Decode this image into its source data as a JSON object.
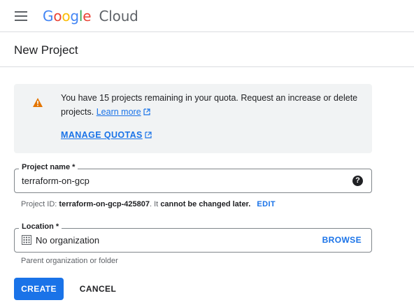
{
  "header": {
    "logo_letters": [
      "G",
      "o",
      "o",
      "g",
      "l",
      "e"
    ],
    "logo_colors": [
      "#4285f4",
      "#ea4335",
      "#fbbc05",
      "#4285f4",
      "#34a853",
      "#ea4335"
    ],
    "logo_suffix": "Cloud",
    "menu_icon": "hamburger-menu-icon"
  },
  "page": {
    "title": "New Project"
  },
  "quota_notice": {
    "text": "You have 15 projects remaining in your quota. Request an increase or delete projects.",
    "learn_more": "Learn more",
    "manage_quotas": "MANAGE QUOTAS",
    "warning_color": "#e37400"
  },
  "project_name": {
    "label": "Project name *",
    "value": "terraform-on-gcp",
    "help_icon": "question-circle-icon"
  },
  "project_id": {
    "prefix": "Project ID:",
    "id": "terraform-on-gcp-425807",
    "middle": ". It",
    "emphasis": "cannot be changed later.",
    "edit_label": "EDIT"
  },
  "location": {
    "label": "Location *",
    "value": "No organization",
    "browse_label": "BROWSE",
    "hint": "Parent organization or folder",
    "icon": "building-icon"
  },
  "actions": {
    "create_label": "CREATE",
    "cancel_label": "CANCEL",
    "primary_color": "#1a73e8"
  }
}
